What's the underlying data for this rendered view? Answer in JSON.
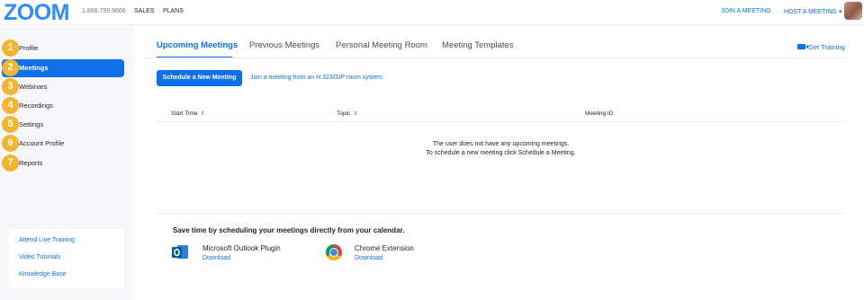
{
  "header": {
    "logo": "ZOOM",
    "phone": "1.888.799.9666",
    "nav": [
      "SALES",
      "PLANS"
    ],
    "join_meeting": "JOIN A MEETING",
    "host_meeting": "HOST A MEETING ▾"
  },
  "sidebar": {
    "items": [
      {
        "num": "1",
        "label": "Profile"
      },
      {
        "num": "2",
        "label": "Meetings",
        "active": true
      },
      {
        "num": "3",
        "label": "Webinars"
      },
      {
        "num": "4",
        "label": "Recordings"
      },
      {
        "num": "5",
        "label": "Settings"
      },
      {
        "num": "6",
        "label": "Account Profile"
      },
      {
        "num": "7",
        "label": "Reports"
      }
    ],
    "help_links": [
      "Attend Live Training",
      "Video Tutorials",
      "Knowledge Base"
    ]
  },
  "main": {
    "tabs": [
      "Upcoming Meetings",
      "Previous Meetings",
      "Personal Meeting Room",
      "Meeting Templates"
    ],
    "get_training": "Get Training",
    "schedule_button": "Schedule a New Meeting",
    "h323_link": "Join a meeting from an H.323/SIP room system",
    "table": {
      "headers": [
        "Start Time",
        "Topic",
        "Meeting ID"
      ],
      "sort_glyph": "⇕",
      "empty_line1": "The user does not have any upcoming meetings.",
      "empty_line2": "To schedule a new meeting click Schedule a Meeting."
    },
    "calendar": {
      "title": "Save time by scheduling your meetings directly from your calendar.",
      "plugins": [
        {
          "name": "Microsoft Outlook Plugin",
          "action": "Download",
          "icon": "outlook-icon"
        },
        {
          "name": "Chrome Extension",
          "action": "Download",
          "icon": "chrome-icon"
        }
      ]
    }
  },
  "colors": {
    "accent": "#0e71eb",
    "badge": "#f2b531",
    "sidebar_bg": "#f7f7fa"
  }
}
